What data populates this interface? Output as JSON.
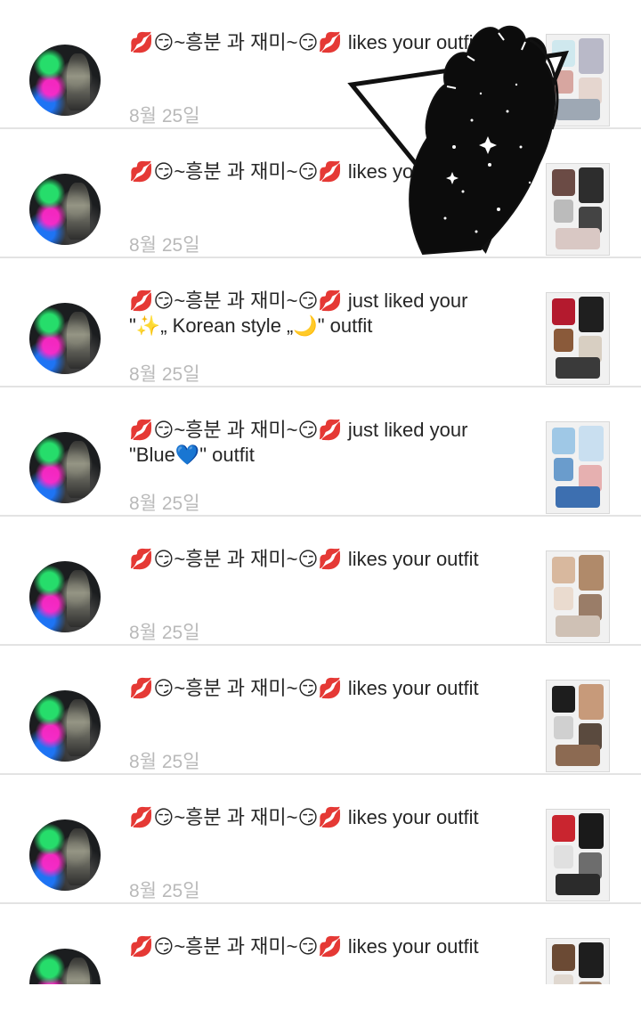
{
  "notifications": [
    {
      "user": "💋😏~흥분 과 재미~😏💋",
      "action": "likes your outfit",
      "outfit": "",
      "date": "8월 25일",
      "thumb_colors": [
        "#cfe8ee",
        "#b9b9c8",
        "#d7a6a0",
        "#e5d6cf",
        "#9ea8b4"
      ]
    },
    {
      "user": "💋😏~흥분 과 재미~😏💋",
      "action": "likes your outfit",
      "outfit": "",
      "date": "8월 25일",
      "thumb_colors": [
        "#6b4b45",
        "#2d2d2d",
        "#bbbbbb",
        "#444444",
        "#d9c8c4"
      ]
    },
    {
      "user": "💋😏~흥분 과 재미~😏💋",
      "action": "just liked your",
      "outfit": "\"✨„ Korean style „🌙\" outfit",
      "date": "8월 25일",
      "thumb_colors": [
        "#b41a2e",
        "#1f1f1f",
        "#8a5a3a",
        "#d8cfc2",
        "#3a3a3a"
      ]
    },
    {
      "user": "💋😏~흥분 과 재미~😏💋",
      "action": "just liked your",
      "outfit": "\"Blue💙\" outfit",
      "date": "8월 25일",
      "thumb_colors": [
        "#9fc8e6",
        "#c9dff0",
        "#6a9ccc",
        "#e6b0b0",
        "#3d6fb0"
      ]
    },
    {
      "user": "💋😏~흥분 과 재미~😏💋",
      "action": "likes your outfit",
      "outfit": "",
      "date": "8월 25일",
      "thumb_colors": [
        "#d8b89e",
        "#b08a6a",
        "#eadbcf",
        "#9a7d68",
        "#cfc1b5"
      ]
    },
    {
      "user": "💋😏~흥분 과 재미~😏💋",
      "action": "likes your outfit",
      "outfit": "",
      "date": "8월 25일",
      "thumb_colors": [
        "#1d1d1d",
        "#c79a7a",
        "#d0d0d0",
        "#5a4a3e",
        "#8c6a52"
      ]
    },
    {
      "user": "💋😏~흥분 과 재미~😏💋",
      "action": "likes your outfit",
      "outfit": "",
      "date": "8월 25일",
      "thumb_colors": [
        "#c9252f",
        "#1a1a1a",
        "#e0e0e0",
        "#6d6d6d",
        "#2b2b2b"
      ]
    },
    {
      "user": "💋😏~흥분 과 재미~😏💋",
      "action": "likes your outfit",
      "outfit": "",
      "date": "",
      "thumb_colors": [
        "#6b4a34",
        "#1e1e1e",
        "#e0d8d0",
        "#a0826a",
        "#3a3a3a"
      ]
    }
  ]
}
